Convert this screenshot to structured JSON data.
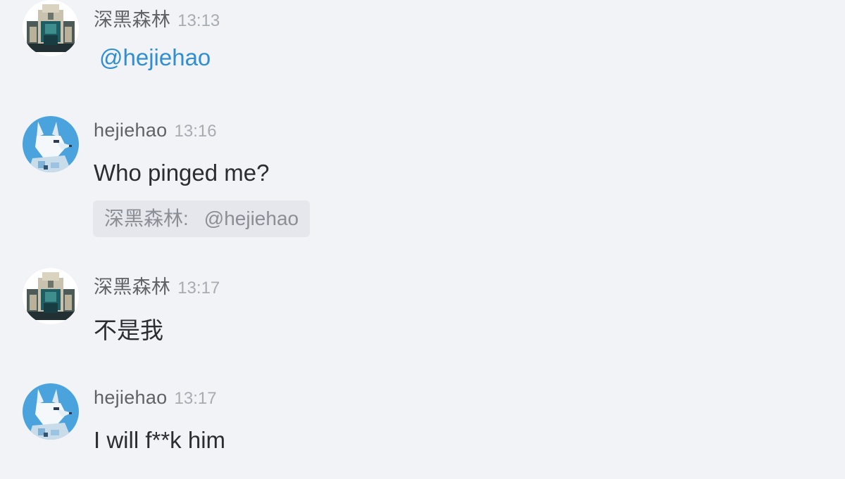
{
  "messages": [
    {
      "author": "深黑森林",
      "time": "13:13",
      "avatar": "castle-avatar",
      "mention": "@hejiehao"
    },
    {
      "author": "hejiehao",
      "time": "13:16",
      "avatar": "fox-avatar",
      "text": "Who pinged me?",
      "quote": {
        "author": "深黑森林",
        "separator": ":",
        "text": "@hejiehao"
      }
    },
    {
      "author": "深黑森林",
      "time": "13:17",
      "avatar": "castle-avatar",
      "text": "不是我"
    },
    {
      "author": "hejiehao",
      "time": "13:17",
      "avatar": "fox-avatar",
      "text": "I will f**k him"
    }
  ],
  "colors": {
    "background": "#f2f3f7",
    "mention": "#2f8fd1",
    "quote_background": "#e6e7ec",
    "fox_avatar_background": "#4aa3dc"
  }
}
